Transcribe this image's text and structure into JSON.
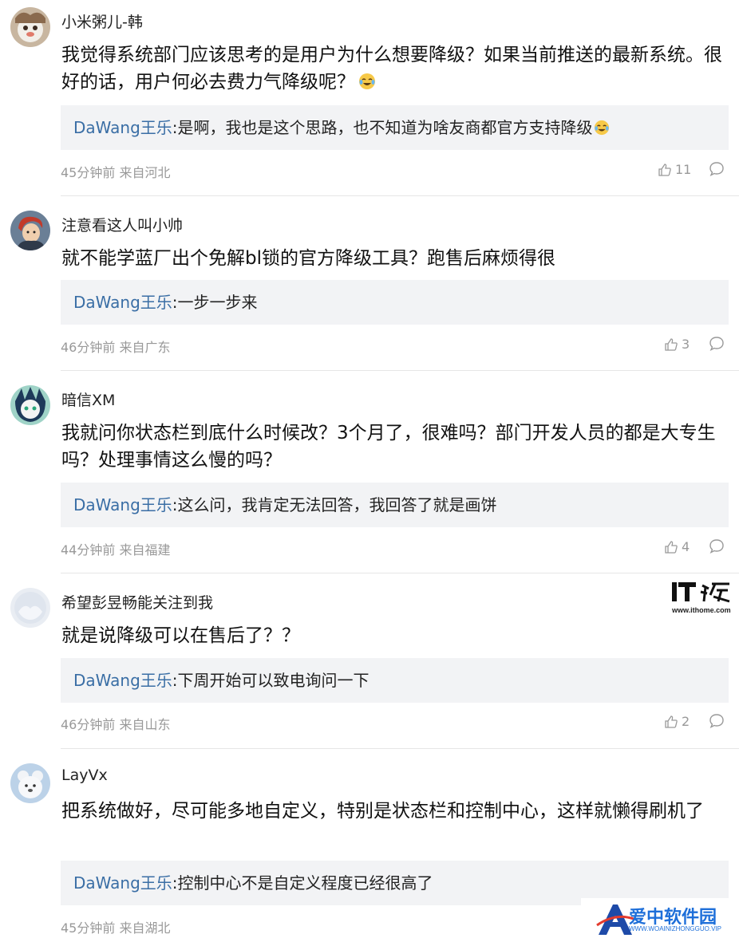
{
  "comments": [
    {
      "username": "小米粥儿-韩",
      "text": "我觉得系统部门应该思考的是用户为什么想要降级？如果当前推送的最新系统。很好的话，用户何必去费力气降级呢？",
      "text_emoji": "laugh-cry-emoji",
      "reply": {
        "author": "DaWang王乐",
        "text": ":是啊，我也是这个思路，也不知道为啥友商都官方支持降级",
        "emoji": "laugh-cry-emoji"
      },
      "time_location": "45分钟前 来自河北",
      "likes": "11"
    },
    {
      "username": "注意看这人叫小帅",
      "text": "就不能学蓝厂出个免解bl锁的官方降级工具？跑售后麻烦得很",
      "reply": {
        "author": "DaWang王乐",
        "text": ":一步一步来"
      },
      "time_location": "46分钟前 来自广东",
      "likes": "3"
    },
    {
      "username": "暗信XM",
      "text": "我就问你状态栏到底什么时候改？3个月了，很难吗？部门开发人员的都是大专生吗？处理事情这么慢的吗？",
      "reply": {
        "author": "DaWang王乐",
        "text": ":这么问，我肯定无法回答，我回答了就是画饼"
      },
      "time_location": "44分钟前 来自福建",
      "likes": "4"
    },
    {
      "username": "希望彭昱畅能关注到我",
      "text": "就是说降级可以在售后了？？",
      "reply": {
        "author": "DaWang王乐",
        "text": ":下周开始可以致电询问一下"
      },
      "time_location": "46分钟前 来自山东",
      "likes": "2"
    },
    {
      "username": "LayVx",
      "text": "把系统做好，尽可能多地自定义，特别是状态栏和控制中心，这样就懒得刷机了",
      "reply": {
        "author": "DaWang王乐",
        "text": ":控制中心不是自定义程度已经很高了"
      },
      "time_location": "45分钟前 来自湖北"
    }
  ],
  "watermark_ithome": {
    "logo": "IT之家",
    "url": "www.ithome.com"
  },
  "watermark_site": {
    "name": "爱中软件园",
    "url": "WWW.WOAINIZHONGGUO.VIP"
  },
  "colors": {
    "reply_author": "#3a6ea5",
    "reply_bg": "#f2f3f5",
    "meta": "#999999",
    "site_brand": "#1e6fd9"
  }
}
